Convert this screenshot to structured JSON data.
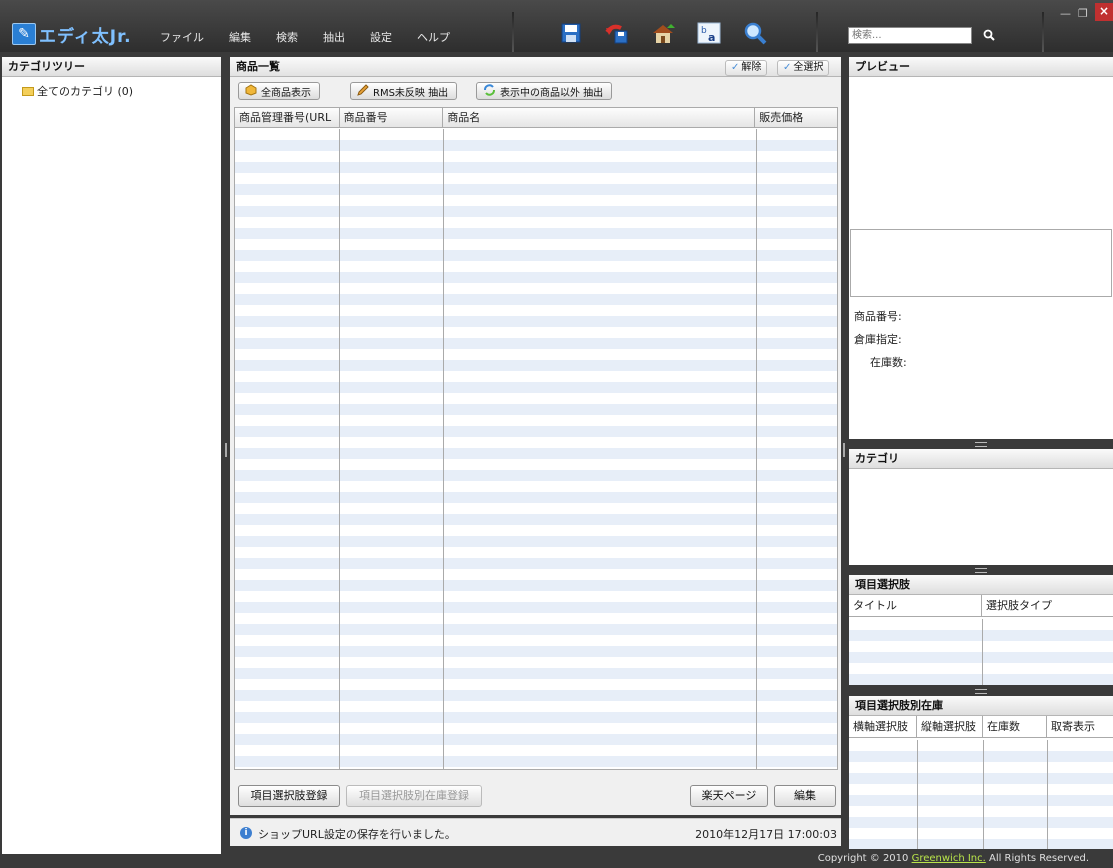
{
  "app": {
    "logo_text": "エディ太Jr."
  },
  "menu": [
    "ファイル",
    "編集",
    "検索",
    "抽出",
    "設定",
    "ヘルプ"
  ],
  "toolbar_icons": [
    "save-icon",
    "undo-save-icon",
    "home-upload-icon",
    "text-replace-icon",
    "search-zoom-icon"
  ],
  "search": {
    "placeholder": "検索..."
  },
  "window": {
    "minimize": "—",
    "maximize": "❐",
    "close": "×"
  },
  "category_tree": {
    "title": "カテゴリツリー",
    "root_label": "全てのカテゴリ (0)"
  },
  "product_list": {
    "title": "商品一覧",
    "deselect_label": "解除",
    "select_all_label": "全選択",
    "show_all_label": "全商品表示",
    "rms_extract_label": "RMS未反映 抽出",
    "extract_other_label": "表示中の商品以外 抽出",
    "columns": [
      "商品管理番号(URL",
      "商品番号",
      "商品名",
      "販売価格"
    ]
  },
  "bottom_buttons": {
    "register_choices": "項目選択肢登録",
    "register_stock": "項目選択肢別在庫登録",
    "rakuten_page": "楽天ページ",
    "edit": "編集"
  },
  "status": {
    "message": "ショップURL設定の保存を行いました。",
    "timestamp": "2010年12月17日 17:00:03"
  },
  "preview": {
    "title": "プレビュー",
    "product_number_label": "商品番号:",
    "warehouse_label": "倉庫指定:",
    "stock_label": "在庫数:"
  },
  "category_panel": {
    "title": "カテゴリ"
  },
  "choice_panel": {
    "title": "項目選択肢",
    "columns": [
      "タイトル",
      "選択肢タイプ"
    ]
  },
  "stock_panel": {
    "title": "項目選択肢別在庫",
    "columns": [
      "横軸選択肢",
      "縦軸選択肢",
      "在庫数",
      "取寄表示"
    ]
  },
  "footer": {
    "prefix": "Copyright © 2010 ",
    "company": "Greenwich Inc.",
    "suffix": " All Rights Reserved."
  },
  "colors": {
    "title_bar": "#3a3a3a",
    "row_stripe": "#e7eef8",
    "link_green": "#b8e44a",
    "close_red": "#c03030"
  }
}
